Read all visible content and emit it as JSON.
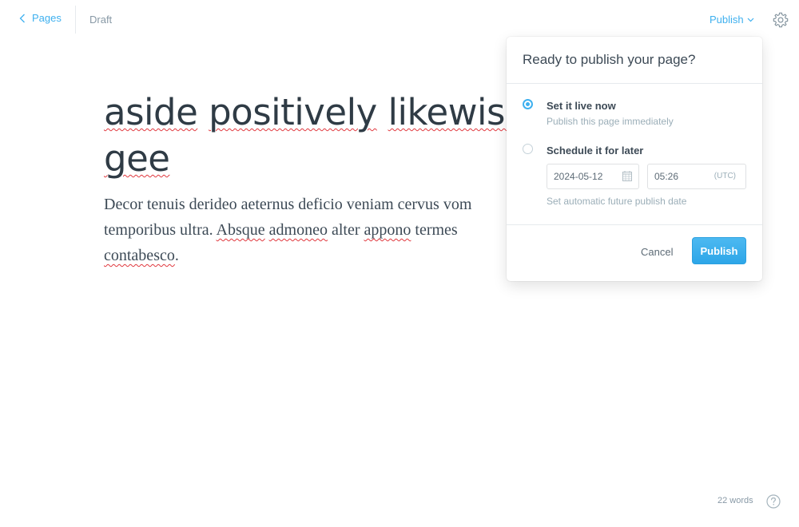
{
  "nav": {
    "back_label": "Pages",
    "status": "Draft"
  },
  "header": {
    "publish_label": "Publish"
  },
  "editor": {
    "title_words": [
      "aside",
      "positively",
      "likewise",
      "gee"
    ],
    "body": {
      "line1": "Decor tenuis derideo aeternus deficio veniam cervus vom",
      "line2_plain_a": "temporibus ultra. ",
      "line2_spell_a": "Absque",
      "line2_space_1": " ",
      "line2_spell_b": "admoneo",
      "line2_plain_b": " alter ",
      "line2_spell_c": "appono",
      "line2_plain_c": " termes",
      "line3_spell": "contabesco",
      "line3_end": "."
    }
  },
  "publish_menu": {
    "heading": "Ready to publish your page?",
    "option_now": {
      "label": "Set it live now",
      "description": "Publish this page immediately",
      "selected": true
    },
    "option_later": {
      "label": "Schedule it for later",
      "selected": false
    },
    "date_value": "2024-05-12",
    "time_value": "05:26",
    "timezone": "(UTC)",
    "schedule_hint": "Set automatic future publish date",
    "cancel_label": "Cancel",
    "publish_label": "Publish"
  },
  "footer": {
    "word_count": "22 words"
  },
  "colors": {
    "accent": "#3eb0ef",
    "spellcheck": "#e0383e"
  },
  "icons": {
    "back": "chevron-left-icon",
    "dropdown": "chevron-down-icon",
    "settings": "gear-icon",
    "calendar": "calendar-icon",
    "help": "question-circle-icon"
  }
}
